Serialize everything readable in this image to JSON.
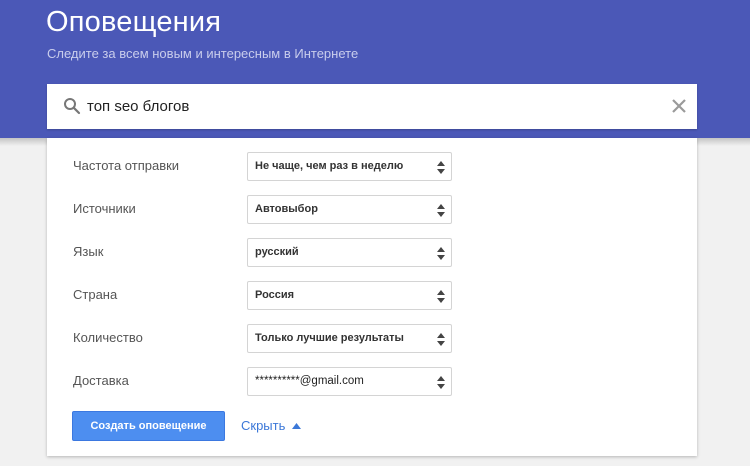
{
  "header": {
    "title": "Оповещения",
    "subtitle": "Следите за всем новым и интересным в Интернете"
  },
  "search": {
    "query": "топ seo блогов"
  },
  "options": [
    {
      "label": "Частота отправки",
      "value": "Не чаще, чем раз в неделю"
    },
    {
      "label": "Источники",
      "value": "Автовыбор"
    },
    {
      "label": "Язык",
      "value": "русский"
    },
    {
      "label": "Страна",
      "value": "Россия"
    },
    {
      "label": "Количество",
      "value": "Только лучшие результаты"
    },
    {
      "label": "Доставка",
      "value": "**********@gmail.com"
    }
  ],
  "actions": {
    "create_label": "Создать оповещение",
    "hide_label": "Скрыть"
  },
  "colors": {
    "header_bg": "#4b58b7",
    "primary_button": "#4d8ef0",
    "link": "#3c78d8"
  },
  "icons": {
    "search": "search-icon",
    "clear": "close-icon",
    "select": "sort-arrows-icon",
    "hide": "caret-up-icon"
  }
}
